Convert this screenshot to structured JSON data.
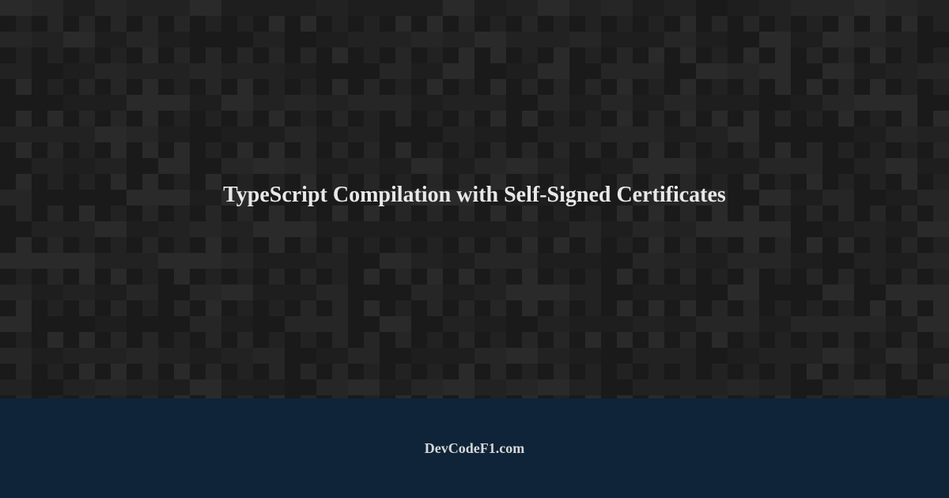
{
  "main": {
    "title": "TypeScript Compilation with Self-Signed Certificates"
  },
  "footer": {
    "brand": "DevCodeF1.com"
  }
}
